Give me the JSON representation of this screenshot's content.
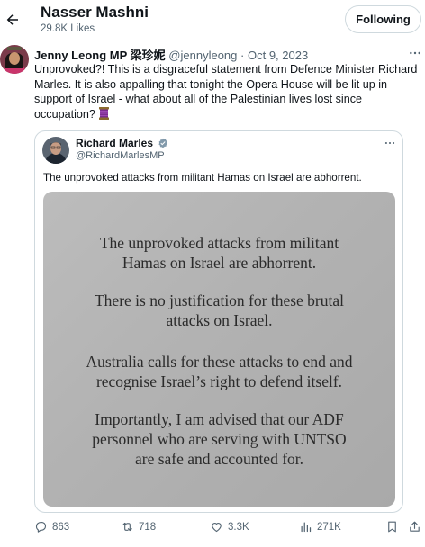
{
  "header": {
    "title": "Nasser Mashni",
    "likes": "29.8K Likes",
    "follow_label": "Following"
  },
  "tweet": {
    "author_name": "Jenny Leong MP 梁珍妮",
    "handle": "@jennyleong",
    "separator": "·",
    "date": "Oct 9, 2023",
    "text": "Unprovoked?! This is a disgraceful statement from Defence Minister Richard Marles. It is also appalling that tonight the Opera House will be lit up in support of Israel - what about all of the Palestinian lives lost since occupation?",
    "emoji": "thread-spool-icon"
  },
  "quote": {
    "author_name": "Richard Marles",
    "handle": "@RichardMarlesMP",
    "text": "The unprovoked attacks from militant Hamas on Israel are abhorrent.",
    "image_paragraphs": [
      [
        "The unprovoked attacks from militant",
        "Hamas on Israel are abhorrent."
      ],
      [
        "There is no justification for these brutal",
        "attacks on Israel."
      ],
      [
        "Australia calls for these attacks to end and",
        "recognise Israel’s right to defend itself."
      ],
      [
        "Importantly, I am advised that our ADF",
        "personnel who are serving with UNTSO",
        "are safe and accounted for."
      ]
    ]
  },
  "actions": {
    "replies": "863",
    "reposts": "718",
    "likes": "3.3K",
    "views": "271K"
  },
  "colors": {
    "text_primary": "#0f1419",
    "text_secondary": "#536471",
    "border": "#cfd9de",
    "verified": "#829aab"
  }
}
